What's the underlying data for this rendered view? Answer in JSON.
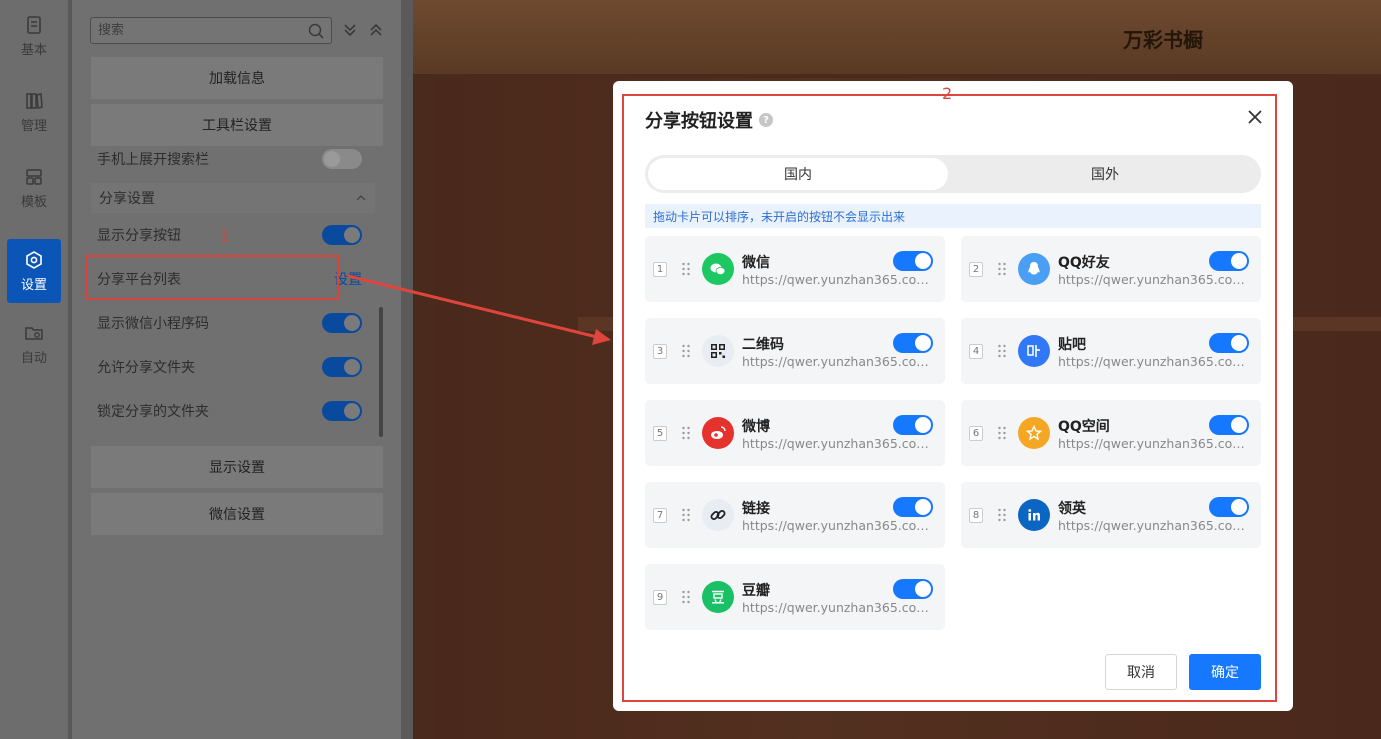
{
  "rail": {
    "items": [
      {
        "label": "基本",
        "icon": "document-icon"
      },
      {
        "label": "管理",
        "icon": "books-icon"
      },
      {
        "label": "模板",
        "icon": "template-icon"
      },
      {
        "label": "设置",
        "icon": "settings-icon",
        "active": true
      },
      {
        "label": "自动",
        "icon": "folder-sync-icon"
      }
    ]
  },
  "panel": {
    "search_placeholder": "搜索",
    "load_info": "加载信息",
    "toolbar_settings": "工具栏设置",
    "mobile_search": "手机上展开搜索栏",
    "share_group": "分享设置",
    "show_share_button": "显示分享按钮",
    "share_platforms": "分享平台列表",
    "share_platforms_link": "设置",
    "show_wechat_code": "显示微信小程序码",
    "allow_share_folder": "允许分享文件夹",
    "lock_shared_folder": "锁定分享的文件夹",
    "display_settings": "显示设置",
    "wechat_settings": "微信设置",
    "annotation": "1"
  },
  "shelf": {
    "title": "万彩书橱"
  },
  "modal": {
    "annotation": "2",
    "title": "分享按钮设置",
    "help": "?",
    "tabs": [
      "国内",
      "国外"
    ],
    "hint": "拖动卡片可以排序，未开启的按钮不会显示出来",
    "cards": [
      {
        "num": "1",
        "name": "微信",
        "url": "https://qwer.yunzhan365.com..."
      },
      {
        "num": "2",
        "name": "QQ好友",
        "url": "https://qwer.yunzhan365.com..."
      },
      {
        "num": "3",
        "name": "二维码",
        "url": "https://qwer.yunzhan365.com..."
      },
      {
        "num": "4",
        "name": "贴吧",
        "url": "https://qwer.yunzhan365.com..."
      },
      {
        "num": "5",
        "name": "微博",
        "url": "https://qwer.yunzhan365.com..."
      },
      {
        "num": "6",
        "name": "QQ空间",
        "url": "https://qwer.yunzhan365.com..."
      },
      {
        "num": "7",
        "name": "链接",
        "url": "https://qwer.yunzhan365.com..."
      },
      {
        "num": "8",
        "name": "领英",
        "url": "https://qwer.yunzhan365.com..."
      },
      {
        "num": "9",
        "name": "豆瓣",
        "url": "https://qwer.yunzhan365.com..."
      }
    ],
    "cancel": "取消",
    "confirm": "确定"
  },
  "colors": {
    "accent": "#1677ff",
    "annotation": "#e0453d",
    "wechat": "#1dc863",
    "qq": "#4a9ff5",
    "qrcode": "#e8ecf3",
    "tieba": "#3178f6",
    "weibo": "#e6322d",
    "qzone": "#f5a623",
    "link": "#e8ecf3",
    "linkedin": "#0a66c2",
    "douban": "#19c065"
  }
}
